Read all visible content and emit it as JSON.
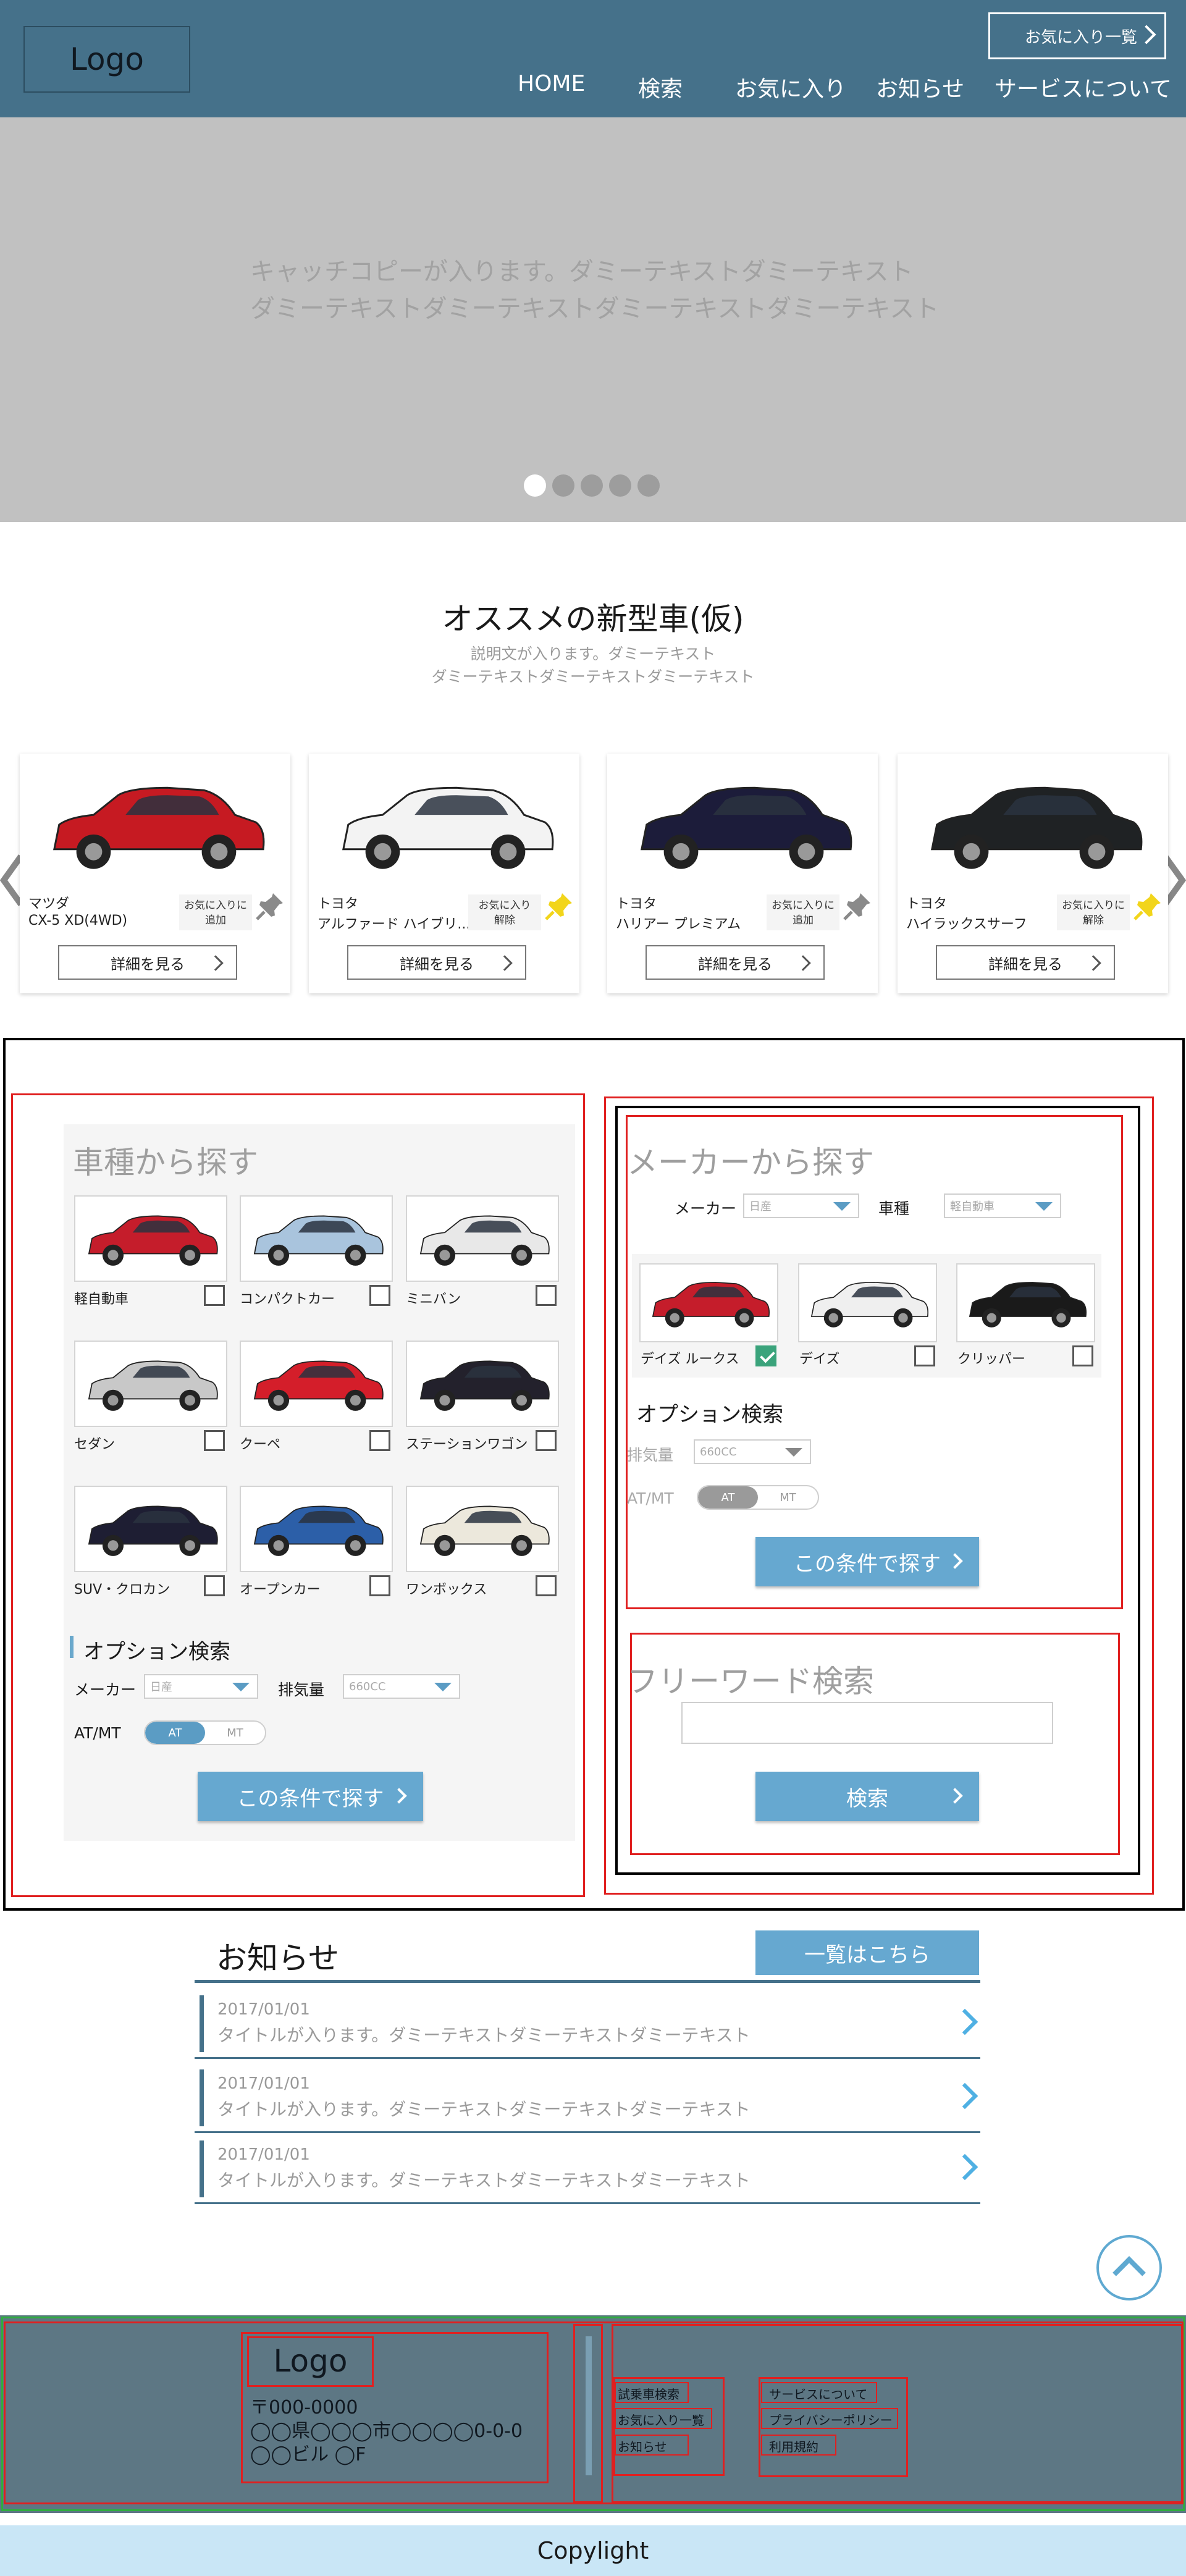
{
  "header": {
    "logo": "Logo",
    "favorites_button": "お気に入り一覧",
    "nav": [
      {
        "label": "HOME"
      },
      {
        "label": "検索"
      },
      {
        "label": "お気に入り"
      },
      {
        "label": "お知らせ"
      },
      {
        "label": "サービスについて"
      }
    ]
  },
  "hero": {
    "catchcopy_line1": "キャッチコピーが入ります。ダミーテキストダミーテキスト",
    "catchcopy_line2": "ダミーテキストダミーテキストダミーテキストダミーテキスト",
    "slide_count": 5,
    "active_slide": 1
  },
  "recommend": {
    "title": "オススメの新型車(仮)",
    "desc_line1": "説明文が入ります。ダミーテキスト",
    "desc_line2": "ダミーテキストダミーテキストダミーテキスト",
    "detail_label": "詳細を見る",
    "cars": [
      {
        "maker": "マツダ",
        "name": "CX-5 XD(4WD)",
        "fav_line1": "お気に入りに",
        "fav_line2": "追加",
        "pinned": false,
        "color": "#c61a22"
      },
      {
        "maker": "トヨタ",
        "name": "アルファード ハイブリ...",
        "fav_line1": "お気に入り",
        "fav_line2": "解除",
        "pinned": true,
        "color": "#f3f3f3"
      },
      {
        "maker": "トヨタ",
        "name": "ハリアー プレミアム",
        "fav_line1": "お気に入りに",
        "fav_line2": "追加",
        "pinned": false,
        "color": "#1c1c3a"
      },
      {
        "maker": "トヨタ",
        "name": "ハイラックスサーフ",
        "fav_line1": "お気に入りに",
        "fav_line2": "解除",
        "pinned": true,
        "color": "#1f2224"
      }
    ]
  },
  "by_type": {
    "title": "車種から探す",
    "types": [
      {
        "label": "軽自動車",
        "color": "#c51d2b"
      },
      {
        "label": "コンパクトカー",
        "color": "#a9c4dd"
      },
      {
        "label": "ミニバン",
        "color": "#e8e8e8"
      },
      {
        "label": "セダン",
        "color": "#c8c8c8"
      },
      {
        "label": "クーペ",
        "color": "#d41e2a"
      },
      {
        "label": "ステーションワゴン",
        "color": "#23212c"
      },
      {
        "label": "SUV・クロカン",
        "color": "#1e1e33"
      },
      {
        "label": "オープンカー",
        "color": "#2c5fa8"
      },
      {
        "label": "ワンボックス",
        "color": "#ece8dc"
      }
    ],
    "option_title": "オプション検索",
    "maker_label": "メーカー",
    "maker_value": "日産",
    "displacement_label": "排気量",
    "displacement_value": "660CC",
    "atmt_label": "AT/MT",
    "at": "AT",
    "mt": "MT",
    "search_button": "この条件で探す"
  },
  "by_maker": {
    "title": "メーカーから探す",
    "maker_label": "メーカー",
    "maker_value": "日産",
    "type_label": "車種",
    "type_value": "軽自動車",
    "models": [
      {
        "label": "デイズ ルークス",
        "checked": true,
        "color": "#c51d2b"
      },
      {
        "label": "デイズ",
        "checked": false,
        "color": "#efefef"
      },
      {
        "label": "クリッパー",
        "checked": false,
        "color": "#1a1a1a"
      }
    ],
    "option_title": "オプション検索",
    "displacement_label": "排気量",
    "displacement_value": "660CC",
    "atmt_label": "AT/MT",
    "at": "AT",
    "mt": "MT",
    "search_button": "この条件で探す"
  },
  "freeword": {
    "title": "フリーワード検索",
    "search_button": "検索"
  },
  "news": {
    "title": "お知らせ",
    "more": "一覧はこちら",
    "items": [
      {
        "date": "2017/01/01",
        "title": "タイトルが入ります。ダミーテキストダミーテキストダミーテキスト"
      },
      {
        "date": "2017/01/01",
        "title": "タイトルが入ります。ダミーテキストダミーテキストダミーテキスト"
      },
      {
        "date": "2017/01/01",
        "title": "タイトルが入ります。ダミーテキストダミーテキストダミーテキスト"
      }
    ]
  },
  "footer": {
    "logo": "Logo",
    "zip": "〒000-0000",
    "address": "◯◯県◯◯◯市◯◯◯◯0-0-0",
    "building": "◯◯ビル ◯F",
    "links_left": [
      "試乗車検索",
      "お気に入り一覧",
      "お知らせ"
    ],
    "links_right": [
      "サービスについて",
      "プライバシーポリシー",
      "利用規約"
    ],
    "copyright": "Copylight"
  },
  "colors": {
    "header_bg": "#45718a",
    "accent": "#66a8d0",
    "footer_bg": "#5d7784",
    "copyright_bg": "#c9e6f6"
  }
}
